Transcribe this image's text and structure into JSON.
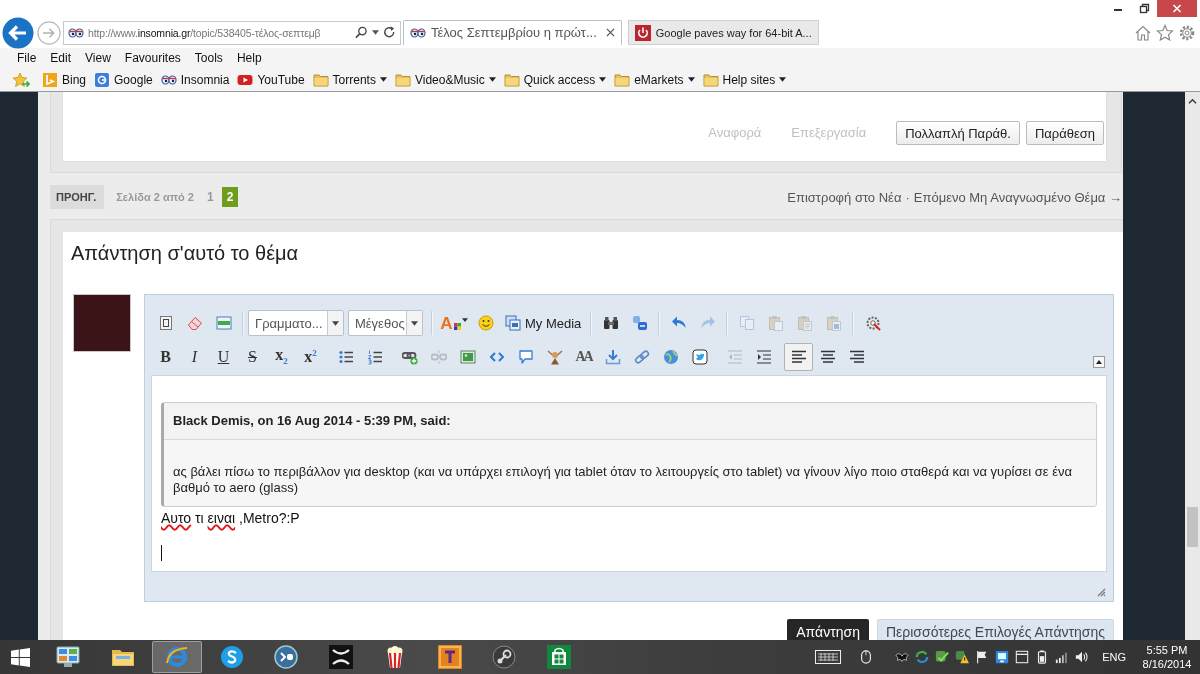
{
  "browser": {
    "address": "http://www.**insomnia.gr**/topic/538405-τέλος-σεπτεμβ",
    "tabs": [
      {
        "kind": "eyes",
        "title": "Τέλος Σεπτεμβρίου η πρώτ...",
        "selected": true
      },
      {
        "kind": "power",
        "title": "Google paves way for 64-bit A...",
        "selected": false
      }
    ],
    "menu": [
      "File",
      "Edit",
      "View",
      "Favourites",
      "Tools",
      "Help"
    ],
    "favorites": [
      {
        "kind": "bing",
        "label": "Bing"
      },
      {
        "kind": "google",
        "label": "Google"
      },
      {
        "kind": "eyes",
        "label": "Insomnia"
      },
      {
        "kind": "youtube",
        "label": "YouTube"
      },
      {
        "kind": "folder",
        "label": "Torrents"
      },
      {
        "kind": "folder",
        "label": "Video&Music"
      },
      {
        "kind": "folder",
        "label": "Quick access"
      },
      {
        "kind": "folder",
        "label": "eMarkets"
      },
      {
        "kind": "folder",
        "label": "Help sites"
      }
    ]
  },
  "post_actions": {
    "links": [
      "Αναφορά",
      "Επεξεργασία"
    ],
    "buttons": [
      "Πολλαπλή Παράθ.",
      "Παράθεση"
    ]
  },
  "pagination": {
    "prev": "ΠΡΟΗΓ.",
    "page_info": "Σελίδα 2 από 2",
    "pages": [
      {
        "label": "1",
        "selected": false
      },
      {
        "label": "2",
        "selected": true
      }
    ],
    "back_link": "Επιστροφή στο Νέα",
    "separator": "·",
    "next_link": "Επόμενο Μη Αναγνωσμένο Θέμα →"
  },
  "reply": {
    "title": "Απάντηση σ'αυτό το θέμα",
    "editor": {
      "toolbar": [
        {
          "groups": [
            [
              {
                "kind": "source",
                "disabled": false
              },
              {
                "kind": "eraser",
                "disabled": false
              },
              {
                "kind": "template",
                "disabled": false
              }
            ],
            [
              {
                "kind": "fontselect",
                "value": "Γραμματο...",
                "disabled": false
              },
              {
                "kind": "sizeselect",
                "value": "Μέγεθος",
                "disabled": false
              }
            ],
            [
              {
                "kind": "fontcolor",
                "label": "A",
                "disabled": false
              },
              {
                "kind": "smiley",
                "disabled": false
              },
              {
                "kind": "media",
                "label": "My Media",
                "disabled": false
              }
            ],
            [
              {
                "kind": "find",
                "disabled": false
              },
              {
                "kind": "bbcode",
                "disabled": false
              }
            ],
            [
              {
                "kind": "undo",
                "disabled": false
              },
              {
                "kind": "redo",
                "disabled": true
              }
            ],
            [
              {
                "kind": "copy",
                "disabled": true
              },
              {
                "kind": "paste",
                "disabled": true
              },
              {
                "kind": "pastetext",
                "disabled": true
              },
              {
                "kind": "pasteword",
                "disabled": true
              }
            ],
            [
              {
                "kind": "spellcheck",
                "disabled": false
              }
            ]
          ]
        },
        {
          "groups": [
            [
              {
                "kind": "bold",
                "label": "B",
                "disabled": false
              },
              {
                "kind": "italic",
                "label": "I",
                "disabled": false
              },
              {
                "kind": "underline",
                "label": "U",
                "disabled": false
              },
              {
                "kind": "strike",
                "label": "S",
                "disabled": false
              },
              {
                "kind": "sub",
                "label": "x$_{2}$",
                "disabled": false
              },
              {
                "kind": "sup",
                "label": "x$^{2}$",
                "disabled": false
              }
            ],
            [
              {
                "kind": "bullets",
                "disabled": false
              },
              {
                "kind": "numbers",
                "disabled": false
              }
            ],
            [
              {
                "kind": "link",
                "disabled": false
              },
              {
                "kind": "unlink",
                "disabled": true
              },
              {
                "kind": "image",
                "disabled": false
              },
              {
                "kind": "code",
                "disabled": false
              },
              {
                "kind": "quote",
                "disabled": false
              },
              {
                "kind": "spoiler",
                "disabled": false
              },
              {
                "kind": "fontsize",
                "label": "AA",
                "disabled": false
              },
              {
                "kind": "import",
                "disabled": false
              },
              {
                "kind": "url",
                "disabled": false
              },
              {
                "kind": "globe",
                "disabled": false
              },
              {
                "kind": "twitter",
                "disabled": false
              }
            ],
            [
              {
                "kind": "outdent",
                "disabled": true
              },
              {
                "kind": "indent",
                "disabled": false
              }
            ],
            [
              {
                "kind": "left",
                "disabled": false,
                "selected": true
              },
              {
                "kind": "center",
                "disabled": false,
                "selected": false
              },
              {
                "kind": "right",
                "disabled": false,
                "selected": false
              }
            ]
          ]
        }
      ],
      "quote": {
        "citation": "Black Demis, on 16 Aug 2014 - 5:39 PM, said:",
        "text": "ας βάλει πίσω το περιβάλλον για desktop (και να υπάρχει επιλογή για tablet όταν το λειτουργείς στο tablet) να γίνουν λίγο ποιο σταθερά και να γυρίσει σε ένα βαθμό το aero (glass)"
      },
      "typed_text": [
        {
          "text": "Αυτο",
          "misspelled": true
        },
        {
          "text": " τι ",
          "misspelled": false
        },
        {
          "text": "ειναι",
          "misspelled": true
        },
        {
          "text": " ,Metro?:P",
          "misspelled": false
        }
      ]
    },
    "buttons": [
      {
        "kind": "primary",
        "label": "Απάντηση"
      },
      {
        "kind": "secondary",
        "label": "Περισσότερες Επιλογές Απάντησης"
      }
    ]
  },
  "taskbar": {
    "apps": [
      {
        "kind": "control-panel",
        "selected": false
      },
      {
        "kind": "explorer",
        "selected": false
      },
      {
        "kind": "ie",
        "selected": true
      },
      {
        "kind": "skype",
        "selected": false
      },
      {
        "kind": "bs",
        "selected": false
      },
      {
        "kind": "xapp",
        "selected": false
      },
      {
        "kind": "popcorn",
        "selected": false
      },
      {
        "kind": "game",
        "selected": false
      },
      {
        "kind": "steam",
        "selected": false
      },
      {
        "kind": "store",
        "selected": false
      }
    ],
    "tray": [
      {
        "kind": "keyboard"
      },
      {
        "kind": "mouse"
      },
      {
        "kind": "bat"
      },
      {
        "kind": "sync"
      },
      {
        "kind": "check"
      },
      {
        "kind": "warning"
      },
      {
        "kind": "flag"
      },
      {
        "kind": "display"
      },
      {
        "kind": "window"
      },
      {
        "kind": "battery"
      },
      {
        "kind": "signal"
      },
      {
        "kind": "volume"
      }
    ],
    "language": "ENG",
    "time": "5:55 PM",
    "date": "8/16/2014"
  }
}
